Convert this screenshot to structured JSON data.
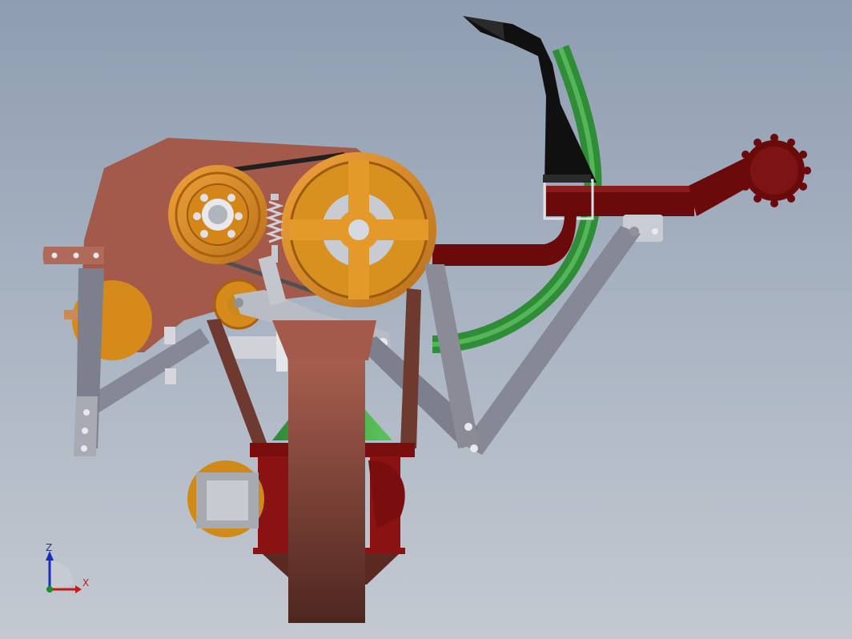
{
  "view": {
    "colors": {
      "frame_red": "#6b0a0a",
      "housing_brown": "#a35a4a",
      "pulley_orange": "#d58a1a",
      "tube_green": "#3c9a3c",
      "link_grey": "#8a8a96",
      "shank_black": "#111111"
    }
  },
  "triad": {
    "z_label": "Z",
    "x_label": "X",
    "z_color": "#1a2dbf",
    "x_color": "#c41a1a",
    "y_color": "#1a8f2a"
  }
}
